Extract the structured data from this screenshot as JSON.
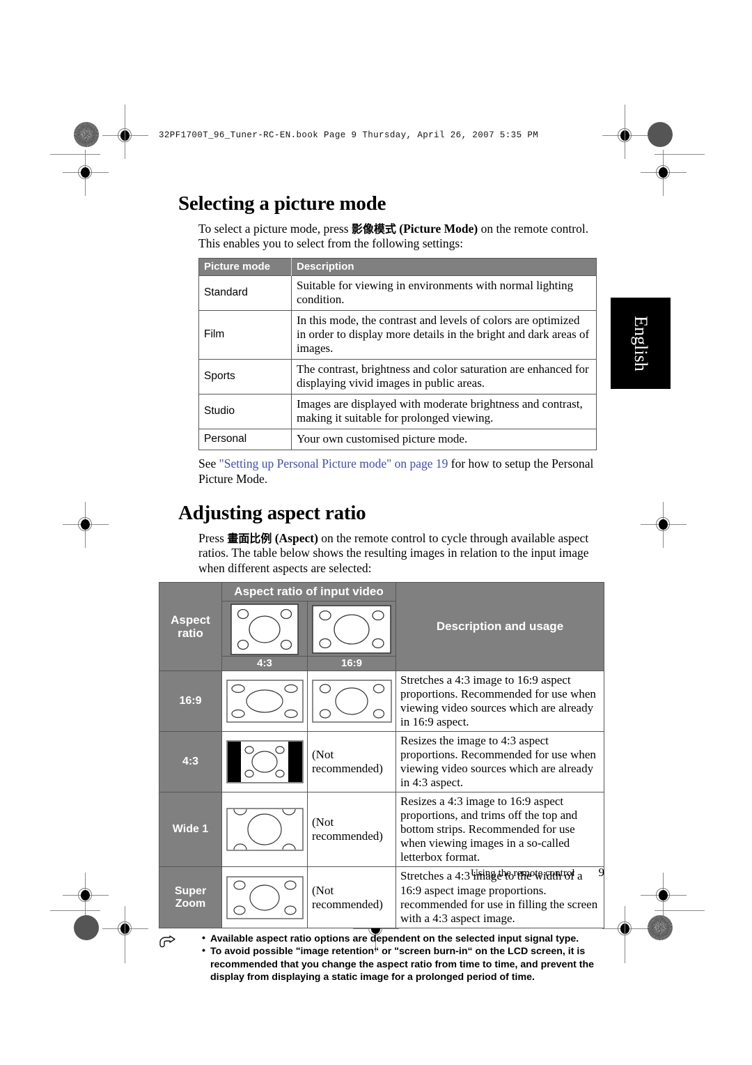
{
  "doc_header": "32PF1700T_96_Tuner-RC-EN.book  Page 9  Thursday, April 26, 2007  5:35 PM",
  "language_tab": "English",
  "section1": {
    "title": "Selecting a picture mode",
    "intro_pre": "To select a picture mode, press ",
    "intro_cjk": "影像模式",
    "intro_bold": "(Picture Mode)",
    "intro_post": " on the remote control. This enables you to select from the following settings:",
    "table": {
      "headers": [
        "Picture mode",
        "Description"
      ],
      "rows": [
        {
          "mode": "Standard",
          "description": "Suitable for viewing in environments with normal lighting condition."
        },
        {
          "mode": "Film",
          "description": "In this mode, the contrast and levels of colors are optimized in order to display more details in the bright and dark areas of images."
        },
        {
          "mode": "Sports",
          "description": "The contrast, brightness and color saturation are enhanced for displaying vivid images in public areas."
        },
        {
          "mode": "Studio",
          "description": "Images are displayed with moderate brightness and contrast, making it suitable for prolonged viewing."
        },
        {
          "mode": "Personal",
          "description": "Your own customised picture mode."
        }
      ]
    },
    "see_pre": "See ",
    "see_link": "\"Setting up Personal Picture mode\" on page 19",
    "see_post": " for how to setup the Personal Picture Mode."
  },
  "section2": {
    "title": "Adjusting aspect ratio",
    "intro_pre": "Press ",
    "intro_cjk": "畫面比例",
    "intro_bold": "(Aspect)",
    "intro_post": " on the remote control to cycle through available aspect ratios. The table below shows the resulting images in relation to the input image when different aspects are selected:",
    "table": {
      "header_group": "Aspect ratio of input video",
      "header_left": "Aspect ratio",
      "header_right": "Description and usage",
      "tick_43": "4:3",
      "tick_169": "16:9",
      "not_recommended": "(Not recommended)",
      "rows": [
        {
          "label": "16:9",
          "thumb_43": "wide-stretched-43-source",
          "thumb_169": "normal-169-source",
          "description": "Stretches a 4:3 image to 16:9 aspect proportions. Recommended for use when viewing video sources which are already in 16:9 aspect."
        },
        {
          "label": "4:3",
          "thumb_43": "pillarboxed-43-source",
          "thumb_169": "not-recommended",
          "description": "Resizes the image to 4:3 aspect proportions. Recommended for use when viewing video sources which are already in 4:3 aspect."
        },
        {
          "label": "Wide 1",
          "thumb_43": "cropped-top-bottom-43-source",
          "thumb_169": "not-recommended",
          "description": "Resizes a 4:3 image to 16:9 aspect proportions, and trims off the top and bottom strips. Recommended for use when viewing images in a so-called letterbox format."
        },
        {
          "label": "Super Zoom",
          "thumb_43": "superzoom-43-source",
          "thumb_169": "not-recommended",
          "description": "Stretches a 4:3 image to the width of a 16:9 aspect image proportions. recommended for use in filling the screen with a 4:3 aspect image."
        }
      ]
    }
  },
  "notes": [
    "Available aspect ratio options are dependent on the selected input signal type.",
    "To avoid possible \"image retention“ or \"screen burn-in“ on the LCD screen, it is recommended that you change the aspect ratio from time to time, and prevent the display from displaying a static image for a prolonged period of time."
  ],
  "footer": {
    "chapter": "Using the remote control",
    "page": "9"
  },
  "colors": {
    "table_header_gray": "#808080",
    "link_blue": "#3b4cc0",
    "tab_black": "#000000"
  }
}
